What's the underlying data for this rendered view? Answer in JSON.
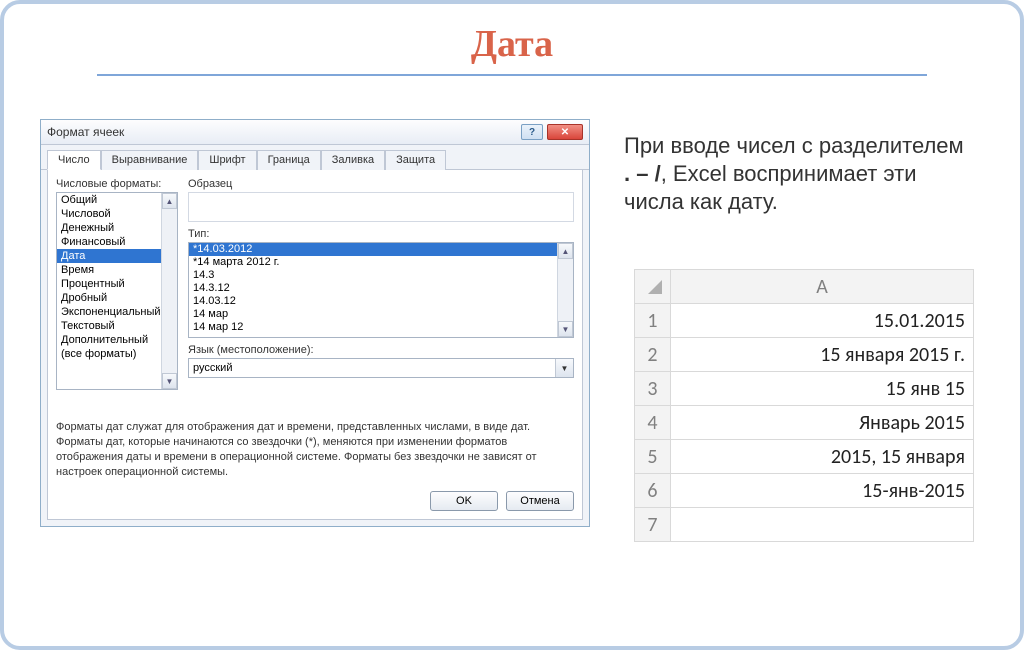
{
  "title": "Дата",
  "dialog": {
    "title": "Формат ячеек",
    "help": "?",
    "close": "✕",
    "tabs": [
      "Число",
      "Выравнивание",
      "Шрифт",
      "Граница",
      "Заливка",
      "Защита"
    ],
    "activeTab": 0,
    "formatsLabel": "Числовые форматы:",
    "formats": [
      "Общий",
      "Числовой",
      "Денежный",
      "Финансовый",
      "Дата",
      "Время",
      "Процентный",
      "Дробный",
      "Экспоненциальный",
      "Текстовый",
      "Дополнительный",
      "(все форматы)"
    ],
    "formatsSelectedIndex": 4,
    "sampleLabel": "Образец",
    "typeLabel": "Тип:",
    "types": [
      "*14.03.2012",
      "*14 марта 2012 г.",
      "14.3",
      "14.3.12",
      "14.03.12",
      "14 мар",
      "14 мар 12"
    ],
    "typesSelectedIndex": 0,
    "localeLabel": "Язык (местоположение):",
    "localeValue": "русский",
    "hint": "Форматы дат служат для отображения дат и времени, представленных числами, в виде дат. Форматы дат, которые начинаются со звездочки (*), меняются при изменении форматов отображения даты и времени в операционной системе. Форматы без звездочки не зависят от настроек операционной системы.",
    "ok": "OK",
    "cancel": "Отмена"
  },
  "explanation": {
    "part1": "При вводе чисел с разделителем ",
    "sep": ". – /",
    "part2": ", Excel воспринимает эти числа как дату."
  },
  "table": {
    "col": "A",
    "rows": [
      "1",
      "2",
      "3",
      "4",
      "5",
      "6",
      "7"
    ],
    "values": [
      "15.01.2015",
      "15 января 2015 г.",
      "15 янв 15",
      "Январь 2015",
      "2015, 15 января",
      "15-янв-2015",
      ""
    ]
  }
}
